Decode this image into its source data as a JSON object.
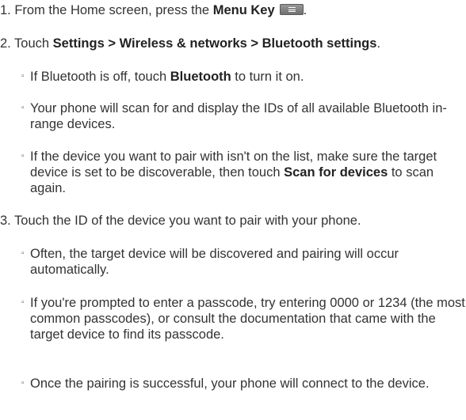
{
  "steps": [
    {
      "pre": "1. From the Home screen, press the ",
      "bold": "Menu Key",
      "icon": "menu-key-icon"
    },
    {
      "pre": "2. Touch ",
      "bold": "Settings > Wireless & networks > Bluetooth settings",
      "post": "."
    },
    {
      "text": "3. Touch the ID of the device you want to pair with your phone."
    }
  ],
  "bullets": {
    "a": {
      "pre": "If Bluetooth is off, touch ",
      "bold": "Bluetooth",
      "post": " to turn it on."
    },
    "b": {
      "text": "Your phone will scan for and display the IDs of all available Bluetooth in-range devices."
    },
    "c": {
      "pre": "If the device you want to pair with isn't on the list, make sure the target device is set to be discoverable, then touch ",
      "bold": "Scan for devices",
      "post": " to scan again."
    },
    "d": {
      "text": "Often, the target device will be discovered and pairing will occur automatically."
    },
    "e": {
      "text": "If you're prompted to enter a passcode, try entering 0000 or 1234 (the most common passcodes), or consult the documentation that came with the target device to find its passcode."
    },
    "f": {
      "text": "Once the pairing is successful, your phone will connect to the device."
    }
  },
  "bullet_marker": "▫"
}
